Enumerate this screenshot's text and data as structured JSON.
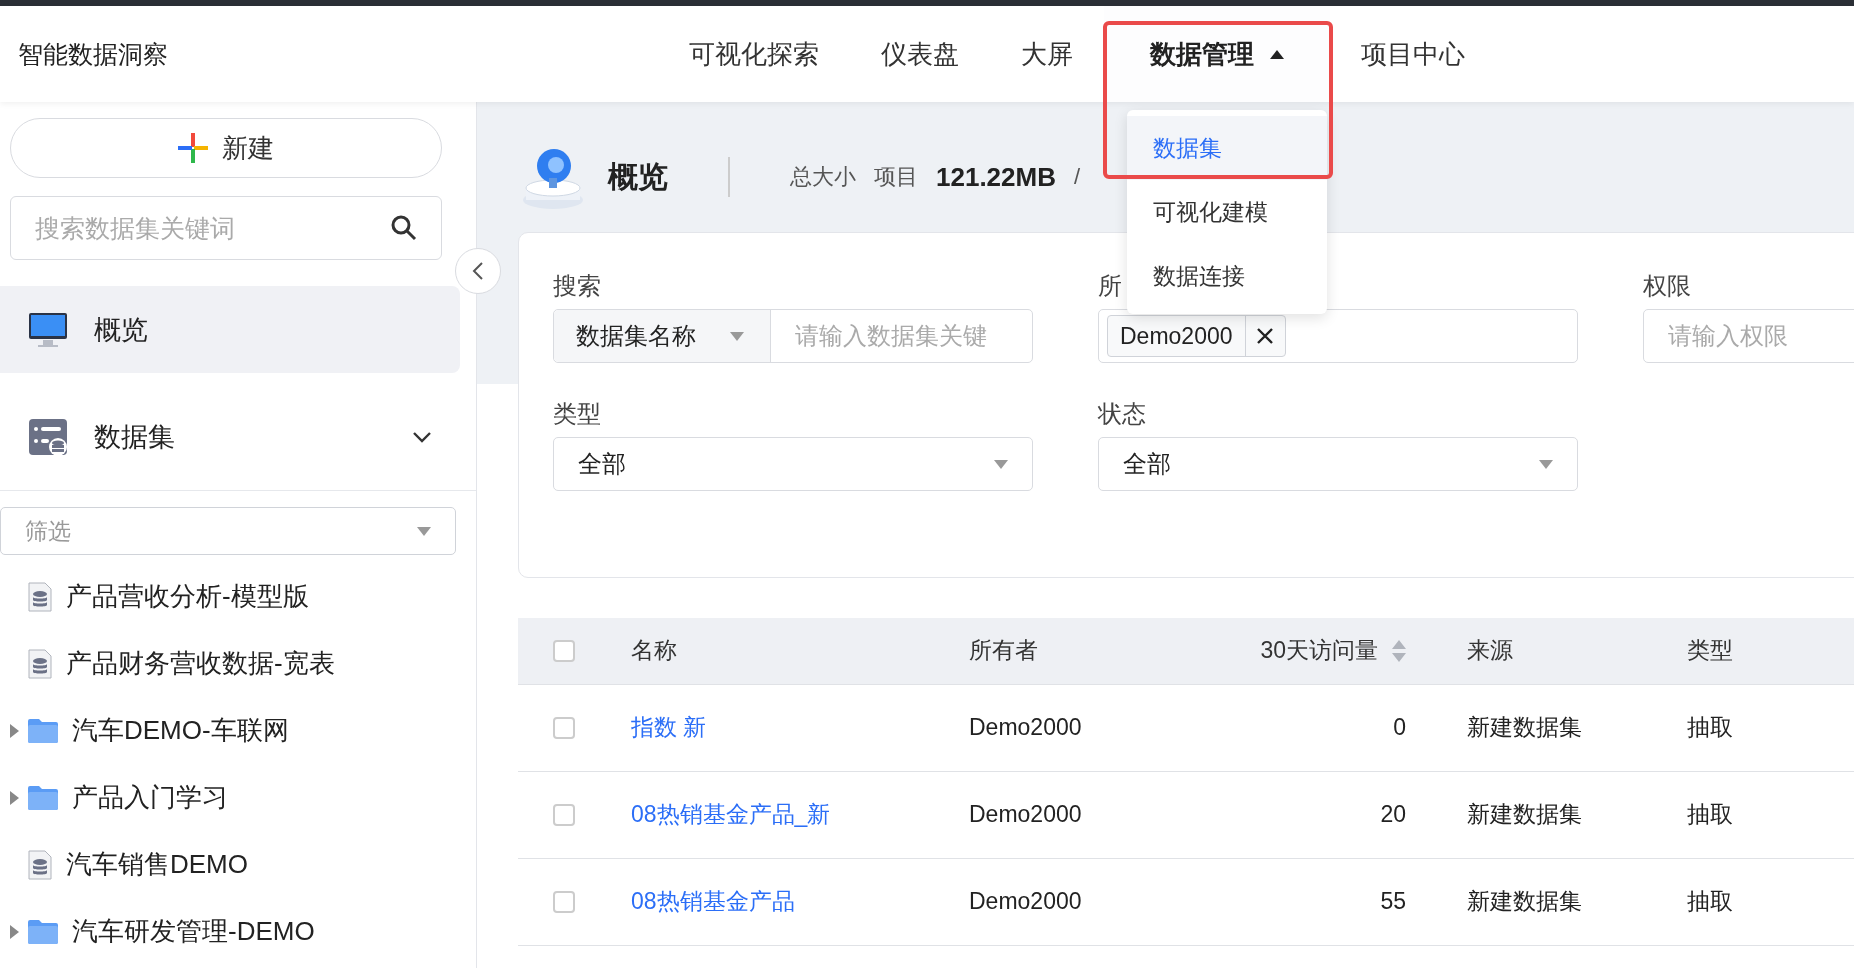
{
  "app_title": "智能数据洞察",
  "nav": [
    {
      "label": "可视化探索",
      "kind": "link",
      "selected": false
    },
    {
      "label": "仪表盘",
      "kind": "link",
      "selected": false
    },
    {
      "label": "大屏",
      "kind": "link",
      "selected": false
    },
    {
      "label": "数据管理",
      "kind": "menu",
      "selected": true,
      "expanded": true
    },
    {
      "label": "项目中心",
      "kind": "link",
      "selected": false
    }
  ],
  "nav_menu": [
    {
      "label": "数据集",
      "selected": true
    },
    {
      "label": "可视化建模",
      "selected": false
    },
    {
      "label": "数据连接",
      "selected": false
    }
  ],
  "sidebar": {
    "new_button": "新建",
    "search_placeholder": "搜索数据集关键词",
    "items": [
      {
        "label": "概览",
        "kind": "overview",
        "selected": true
      },
      {
        "label": "数据集",
        "kind": "datasets",
        "selected": false,
        "expanded": false
      }
    ],
    "filter_placeholder": "筛选",
    "tree": [
      {
        "label": "产品营收分析-模型版",
        "kind": "dataset"
      },
      {
        "label": "产品财务营收数据-宽表",
        "kind": "dataset"
      },
      {
        "label": "汽车DEMO-车联网",
        "kind": "folder",
        "expanded": false
      },
      {
        "label": "产品入门学习",
        "kind": "folder",
        "expanded": false
      },
      {
        "label": "汽车销售DEMO",
        "kind": "dataset"
      },
      {
        "label": "汽车研发管理-DEMO",
        "kind": "folder",
        "expanded": false
      }
    ]
  },
  "overview": {
    "title": "概览",
    "size_label": "总大小",
    "scope_label": "项目",
    "size_value": "121.22MB",
    "separator": "/"
  },
  "filters": {
    "search_label": "搜索",
    "search_by": "数据集名称",
    "search_placeholder": "请输入数据集关键",
    "owner_label": "所",
    "owner_tags": [
      "Demo2000"
    ],
    "permission_label": "权限",
    "permission_placeholder": "请输入权限",
    "type_label": "类型",
    "type_value": "全部",
    "status_label": "状态",
    "status_value": "全部"
  },
  "table": {
    "all_checked": false,
    "columns": [
      {
        "label": "名称",
        "sortable": false
      },
      {
        "label": "所有者",
        "sortable": false
      },
      {
        "label": "30天访问量",
        "sortable": true
      },
      {
        "label": "来源",
        "sortable": false
      },
      {
        "label": "类型",
        "sortable": false
      }
    ],
    "rows": [
      {
        "checked": false,
        "name": "指数 新",
        "owner": "Demo2000",
        "visits": "0",
        "source": "新建数据集",
        "type": "抽取"
      },
      {
        "checked": false,
        "name": "08热销基金产品_新",
        "owner": "Demo2000",
        "visits": "20",
        "source": "新建数据集",
        "type": "抽取"
      },
      {
        "checked": false,
        "name": "08热销基金产品",
        "owner": "Demo2000",
        "visits": "55",
        "source": "新建数据集",
        "type": "抽取"
      }
    ]
  }
}
